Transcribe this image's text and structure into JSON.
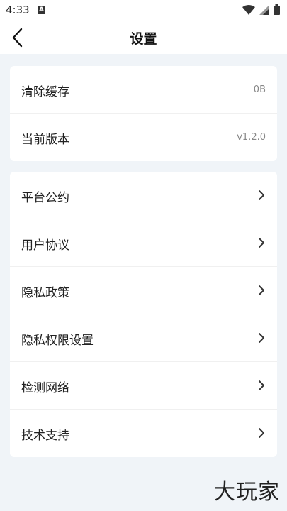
{
  "status": {
    "time": "4:33",
    "notif_letter": "A"
  },
  "header": {
    "title": "设置",
    "back_icon": "chevron-left-icon"
  },
  "cache_card": {
    "items": [
      {
        "label": "清除缓存",
        "value": "0B"
      },
      {
        "label": "当前版本",
        "value": "v1.2.0"
      }
    ]
  },
  "menu_card": {
    "items": [
      {
        "label": "平台公约"
      },
      {
        "label": "用户协议"
      },
      {
        "label": "隐私政策"
      },
      {
        "label": "隐私权限设置"
      },
      {
        "label": "检测网络"
      },
      {
        "label": "技术支持"
      }
    ]
  },
  "watermark": {
    "text": "大玩家"
  }
}
